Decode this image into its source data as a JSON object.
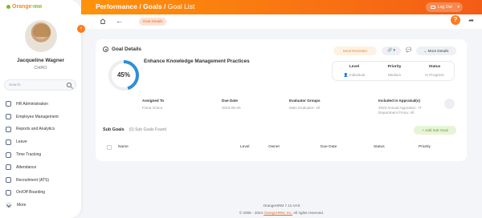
{
  "brand": {
    "logo_text": "Orange",
    "logo_hr": "HRM",
    "accent": "#ff7b1d"
  },
  "user": {
    "name": "Jacqueline Wagner",
    "role": "CHRO"
  },
  "sidebar": {
    "search_placeholder": "Search",
    "items": [
      {
        "label": "HR Administration",
        "icon": "hr-admin-icon"
      },
      {
        "label": "Employee Management",
        "icon": "employee-icon"
      },
      {
        "label": "Reports and Analytics",
        "icon": "reports-icon"
      },
      {
        "label": "Leave",
        "icon": "leave-icon"
      },
      {
        "label": "Time Tracking",
        "icon": "time-icon"
      },
      {
        "label": "Attendance",
        "icon": "attendance-icon"
      },
      {
        "label": "Recruitment (ATS)",
        "icon": "recruitment-icon"
      },
      {
        "label": "On/Off Boarding",
        "icon": "onboarding-icon"
      }
    ],
    "more_label": "More"
  },
  "topbar": {
    "breadcrumb_main": "Performance / Goals / ",
    "breadcrumb_sub": "Goal List",
    "logout_label": "Log Out"
  },
  "subbar": {
    "pill_label": "Goal Details"
  },
  "goal": {
    "section_title": "Goal Details",
    "send_reminder": "Send Reminder",
    "more_details": "More Details",
    "progress_percent": 45,
    "progress_label": "45%",
    "name": "Enhance Knowledge Management Practices",
    "level_label": "Level",
    "level_value": "Individual",
    "priority_label": "Priority",
    "priority_value": "Medium",
    "status_label": "Status",
    "status_value": "In Progress",
    "assigned_label": "Assigned To",
    "assigned_value": "Fiona Grace",
    "due_label": "Due Date",
    "due_value": "2023-09-30",
    "evaluator_label": "Evaluator Groups",
    "evaluator_value": "Main Evaluator: All",
    "appraisal_label": "Included in Appraisal(s)",
    "appraisal_value_1": "2023 Annual Appraisal - IT",
    "appraisal_value_2": "Department Fiona: All"
  },
  "subgoals": {
    "title": "Sub Goals",
    "count": "(0) Sub Goals Found",
    "add_label": "Add Sub Goal",
    "columns": [
      "Name",
      "Level",
      "Owner",
      "Due Date",
      "Status",
      "Priority"
    ]
  },
  "footer": {
    "version": "OrangeHRM 7.11-VAS",
    "copyright_prefix": "© 2005 - 2024 ",
    "copyright_link": "OrangeHRM, Inc.",
    "copyright_suffix": " All rights reserved."
  }
}
